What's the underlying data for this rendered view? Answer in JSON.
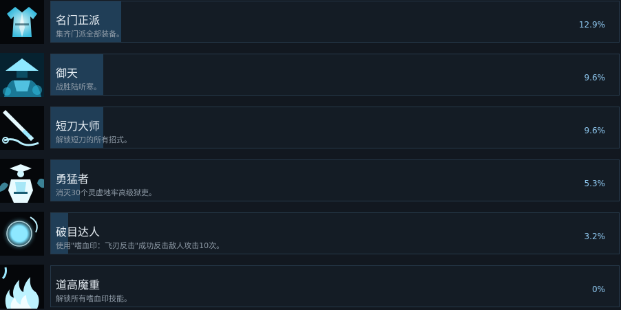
{
  "achievements": [
    {
      "title": "名门正派",
      "description": "集齐门派全部装备。",
      "percent_label": "12.9%",
      "percent": 12.9,
      "icon": "robe-icon"
    },
    {
      "title": "御天",
      "description": "战胜陆听寒。",
      "percent_label": "9.6%",
      "percent": 9.6,
      "icon": "straw-hat-swordsman-icon"
    },
    {
      "title": "短刀大师",
      "description": "解锁短刀的所有招式。",
      "percent_label": "9.6%",
      "percent": 9.6,
      "icon": "dagger-icon"
    },
    {
      "title": "勇猛者",
      "description": "消灭30个灵虚地牢高级狱吏。",
      "percent_label": "5.3%",
      "percent": 5.3,
      "icon": "warrior-icon"
    },
    {
      "title": "破目达人",
      "description": "使用\"嗜血印：飞刃反击\"成功反击敌人攻击10次。",
      "percent_label": "3.2%",
      "percent": 3.2,
      "icon": "energy-orb-icon"
    },
    {
      "title": "道高魔重",
      "description": "解锁所有嗜血印技能。",
      "percent_label": "0%",
      "percent": 0,
      "icon": "spirit-flame-icon"
    }
  ],
  "colors": {
    "background": "#121820",
    "panel": "#141c25",
    "panel_border": "#26394a",
    "progress_fill": "#203e57",
    "title_text": "#e6edf3",
    "description_text": "#8e9aa6",
    "percent_text": "#8fc8f0",
    "icon_glow": "#7fe3ff"
  }
}
